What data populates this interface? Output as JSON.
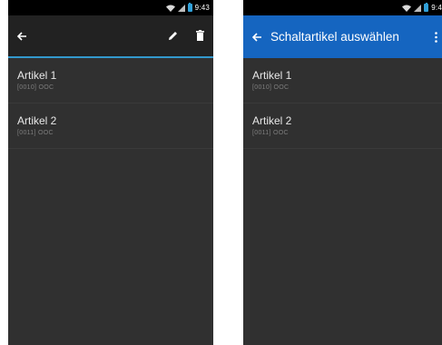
{
  "left_screen": {
    "status": {
      "time": "9:43"
    },
    "toolbar": {
      "back_icon": "arrow-left-icon",
      "edit_icon": "pencil-icon",
      "delete_icon": "trash-icon"
    },
    "items": [
      {
        "title": "Artikel 1",
        "subtitle": "[0010] OOC"
      },
      {
        "title": "Artikel 2",
        "subtitle": "[0011] OOC"
      }
    ]
  },
  "right_screen": {
    "status": {
      "time": "9:4"
    },
    "toolbar": {
      "back_icon": "arrow-left-icon",
      "title": "Schaltartikel auswählen",
      "menu_icon": "overflow-menu-icon"
    },
    "items": [
      {
        "title": "Artikel 1",
        "subtitle": "[0010] OOC"
      },
      {
        "title": "Artikel 2",
        "subtitle": "[0011] OOC"
      }
    ]
  },
  "colors": {
    "background": "#303030",
    "statusbar": "#000000",
    "left_toolbar": "#222222",
    "left_toolbar_accent": "#3398cc",
    "right_toolbar": "#1565c0",
    "battery": "#31a0d8"
  }
}
